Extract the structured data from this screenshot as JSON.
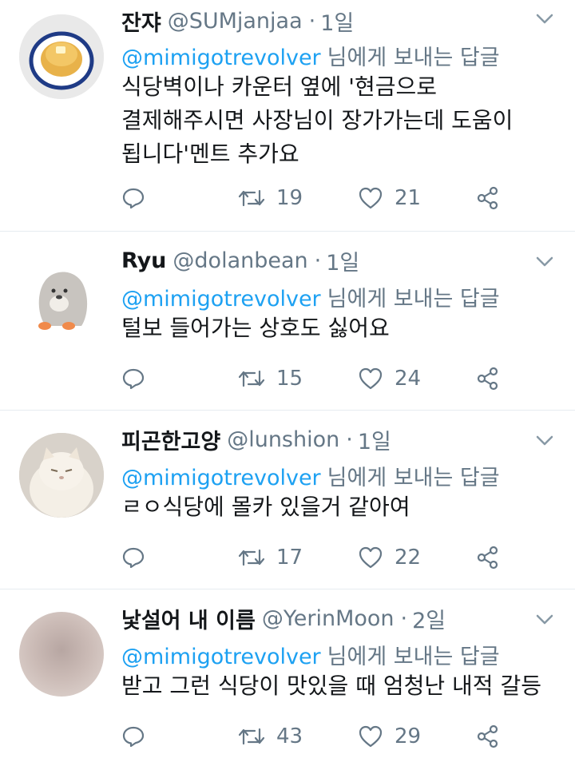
{
  "reply_prefix": "님에게 보내는 답글",
  "tweets": [
    {
      "name": "잔쟈",
      "handle": "@SUMjanjaa",
      "dot": "·",
      "time": "1일",
      "mention": "@mimigotrevolver",
      "lines": [
        "식당벽이나 카운터 옆에 '현금으로",
        "결제해주시면 사장님이 장가가는데 도움이",
        "됩니다'멘트 추가요"
      ],
      "retweets": "19",
      "likes": "21"
    },
    {
      "name": "Ryu",
      "handle": "@dolanbean",
      "dot": "·",
      "time": "1일",
      "mention": "@mimigotrevolver",
      "lines": [
        "털보 들어가는 상호도 싫어요"
      ],
      "retweets": "15",
      "likes": "24"
    },
    {
      "name": "피곤한고양",
      "handle": "@lunshion",
      "dot": "·",
      "time": "1일",
      "mention": "@mimigotrevolver",
      "lines": [
        "ㄹㅇ식당에 몰카 있을거 같아여"
      ],
      "retweets": "17",
      "likes": "22"
    },
    {
      "name": "낯설어 내 이름",
      "handle": "@YerinMoon",
      "dot": "·",
      "time": "2일",
      "mention": "@mimigotrevolver",
      "lines": [
        "받고 그런 식당이 맛있을 때 엄청난 내적 갈등"
      ],
      "retweets": "43",
      "likes": "29"
    }
  ],
  "colors": {
    "text": "#14171a",
    "secondary": "#657786",
    "link": "#1da1f2",
    "divider": "#e6ecf0"
  }
}
